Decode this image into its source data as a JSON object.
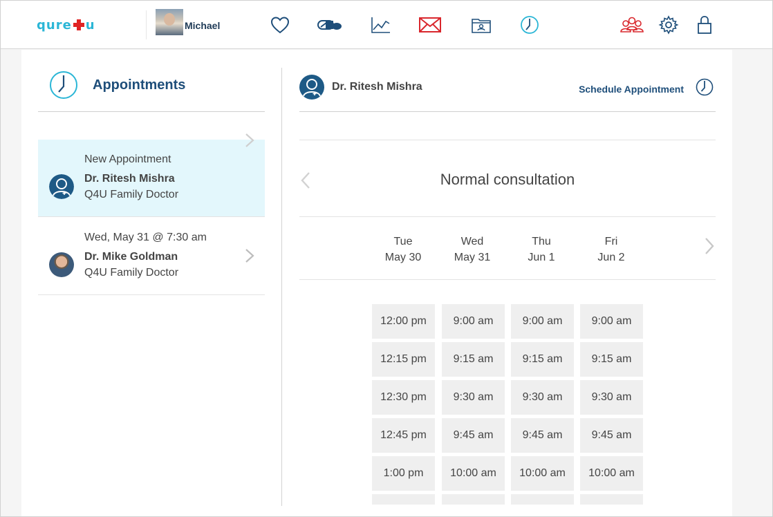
{
  "app": {
    "logo_left": "qure",
    "logo_right": "u",
    "username": "Michael"
  },
  "nav": [
    {
      "name": "heart-icon"
    },
    {
      "name": "pills-icon"
    },
    {
      "name": "chart-icon"
    },
    {
      "name": "mail-icon"
    },
    {
      "name": "folder-icon"
    },
    {
      "name": "clock-icon"
    },
    {
      "name": "people-icon"
    },
    {
      "name": "gear-icon"
    },
    {
      "name": "lock-icon"
    }
  ],
  "colors": {
    "brand": "#2bb6d6",
    "accent_red": "#d9262c",
    "navy": "#1e4e7a",
    "active_bg": "#e3f7fc"
  },
  "appointments": {
    "title": "Appointments",
    "items": [
      {
        "line1": "New Appointment",
        "doctor": "Dr. Ritesh Mishra",
        "clinic": "Q4U Family Doctor",
        "active": true
      },
      {
        "line1": "Wed, May 31 @ 7:30 am",
        "doctor": "Dr. Mike Goldman",
        "clinic": "Q4U Family Doctor",
        "active": false
      }
    ]
  },
  "detail": {
    "doctor": "Dr. Ritesh Mishra",
    "schedule_label": "Schedule Appointment",
    "consultation": "Normal consultation",
    "days": [
      {
        "dow": "Tue",
        "date": "May 30"
      },
      {
        "dow": "Wed",
        "date": "May 31"
      },
      {
        "dow": "Thu",
        "date": "Jun 1"
      },
      {
        "dow": "Fri",
        "date": "Jun 2"
      }
    ],
    "slots": [
      [
        "12:00 pm",
        "12:15 pm",
        "12:30 pm",
        "12:45 pm",
        "1:00 pm"
      ],
      [
        "9:00 am",
        "9:15 am",
        "9:30 am",
        "9:45 am",
        "10:00 am"
      ],
      [
        "9:00 am",
        "9:15 am",
        "9:30 am",
        "9:45 am",
        "10:00 am"
      ],
      [
        "9:00 am",
        "9:15 am",
        "9:30 am",
        "9:45 am",
        "10:00 am"
      ]
    ]
  }
}
